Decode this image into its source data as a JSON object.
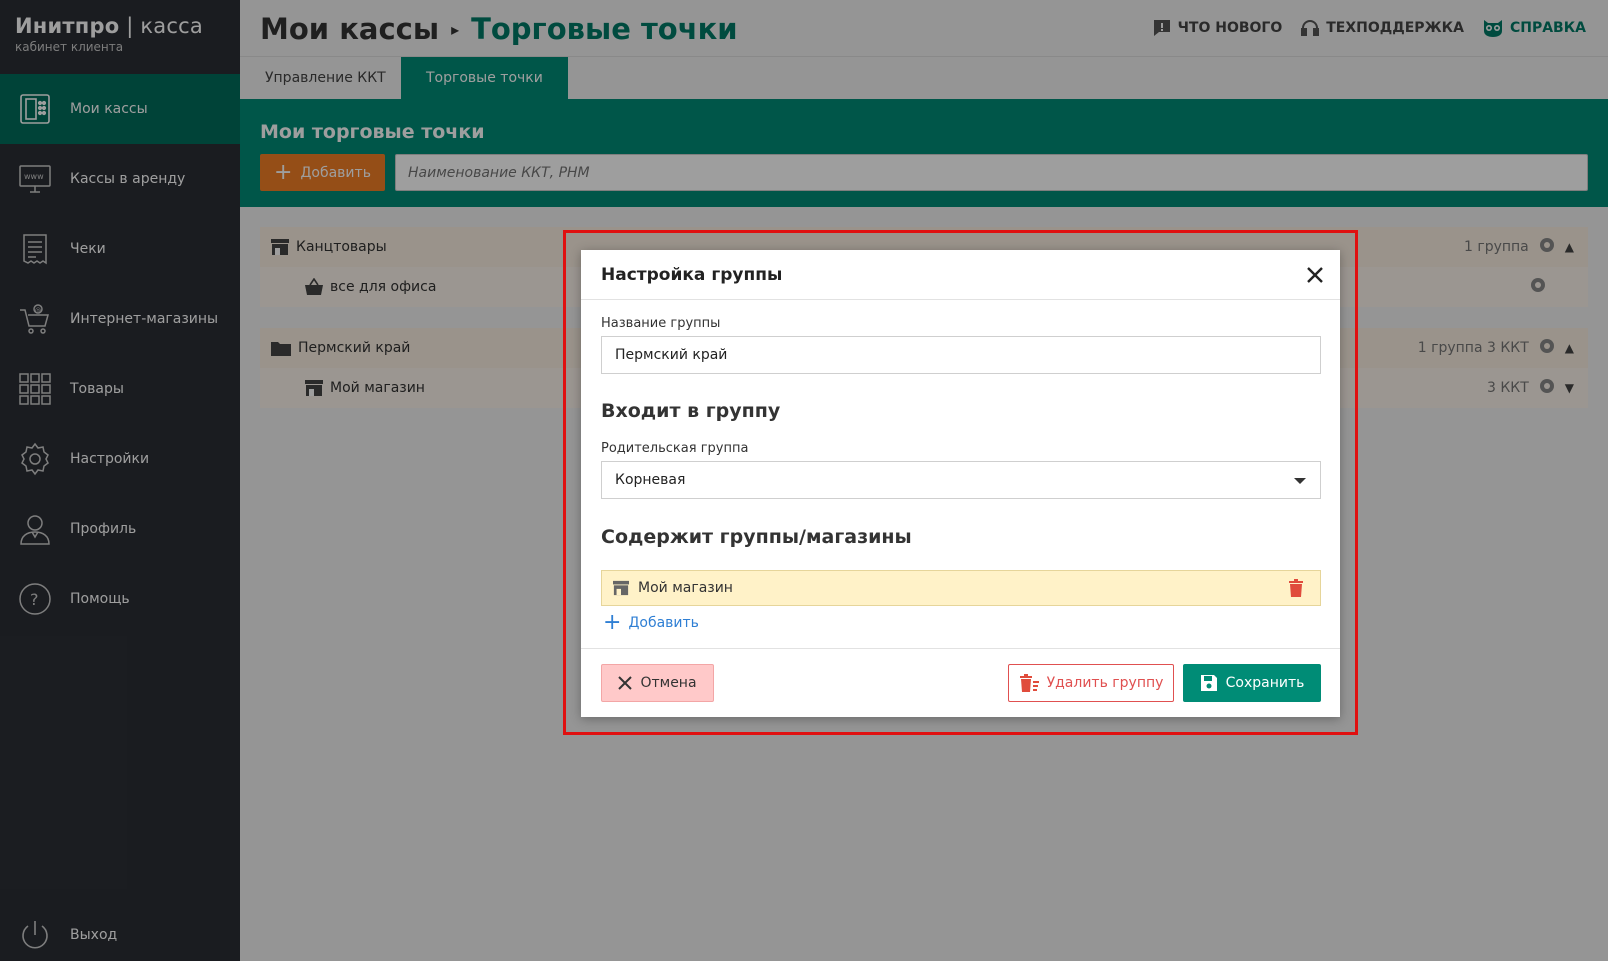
{
  "brand": {
    "name": "Инитпро",
    "sep": " | ",
    "product": "касса",
    "sub": "кабинет клиента"
  },
  "sidebar": {
    "items": [
      {
        "label": "Мои кассы",
        "icon": "cash-register-icon",
        "active": true
      },
      {
        "label": "Кассы в аренду",
        "icon": "www-monitor-icon"
      },
      {
        "label": "Чеки",
        "icon": "receipt-icon"
      },
      {
        "label": "Интернет-магазины",
        "icon": "online-cart-icon"
      },
      {
        "label": "Товары",
        "icon": "grid-icon"
      },
      {
        "label": "Настройки",
        "icon": "gear-icon"
      },
      {
        "label": "Профиль",
        "icon": "user-icon"
      },
      {
        "label": "Помощь",
        "icon": "help-icon"
      }
    ],
    "logout": {
      "label": "Выход",
      "icon": "power-icon"
    }
  },
  "header": {
    "crumb1": "Мои кассы",
    "crumb2": "Торговые точки",
    "links": [
      {
        "label": "ЧТО НОВОГО",
        "icon": "news-icon"
      },
      {
        "label": "ТЕХПОДДЕРЖКА",
        "icon": "headset-icon"
      },
      {
        "label": "СПРАВКА",
        "icon": "owl-icon"
      }
    ]
  },
  "tabs": [
    {
      "label": "Управление ККТ"
    },
    {
      "label": "Торговые точки",
      "active": true
    }
  ],
  "band": {
    "title": "Мои торговые точки",
    "add_label": "Добавить",
    "search_placeholder": "Наименование ККТ, РНМ"
  },
  "groups": [
    {
      "name": "Канцтовары",
      "info": "1 группа",
      "icon": "store-icon",
      "children": [
        {
          "name": "все для офиса",
          "info": "",
          "icon": "basket-icon"
        }
      ]
    },
    {
      "name": "Пермский край",
      "info": "1 группа 3 ККТ",
      "icon": "folder-icon",
      "children": [
        {
          "name": "Мой магазин",
          "info": "3 ККТ",
          "icon": "store-icon"
        }
      ]
    }
  ],
  "modal": {
    "title": "Настройка группы",
    "name_label": "Название группы",
    "name_value": "Пермский край",
    "parent_section": "Входит в группу",
    "parent_label": "Родительская группа",
    "parent_value": "Корневая",
    "contains_section": "Содержит группы/магазины",
    "contains_items": [
      {
        "name": "Мой магазин"
      }
    ],
    "add_label": "Добавить",
    "cancel_label": "Отмена",
    "delete_label": "Удалить группу",
    "save_label": "Сохранить"
  },
  "colors": {
    "accent": "#008c76",
    "sidebar": "#2b2e35",
    "orange": "#f07e26",
    "highlight": "#e01010"
  }
}
